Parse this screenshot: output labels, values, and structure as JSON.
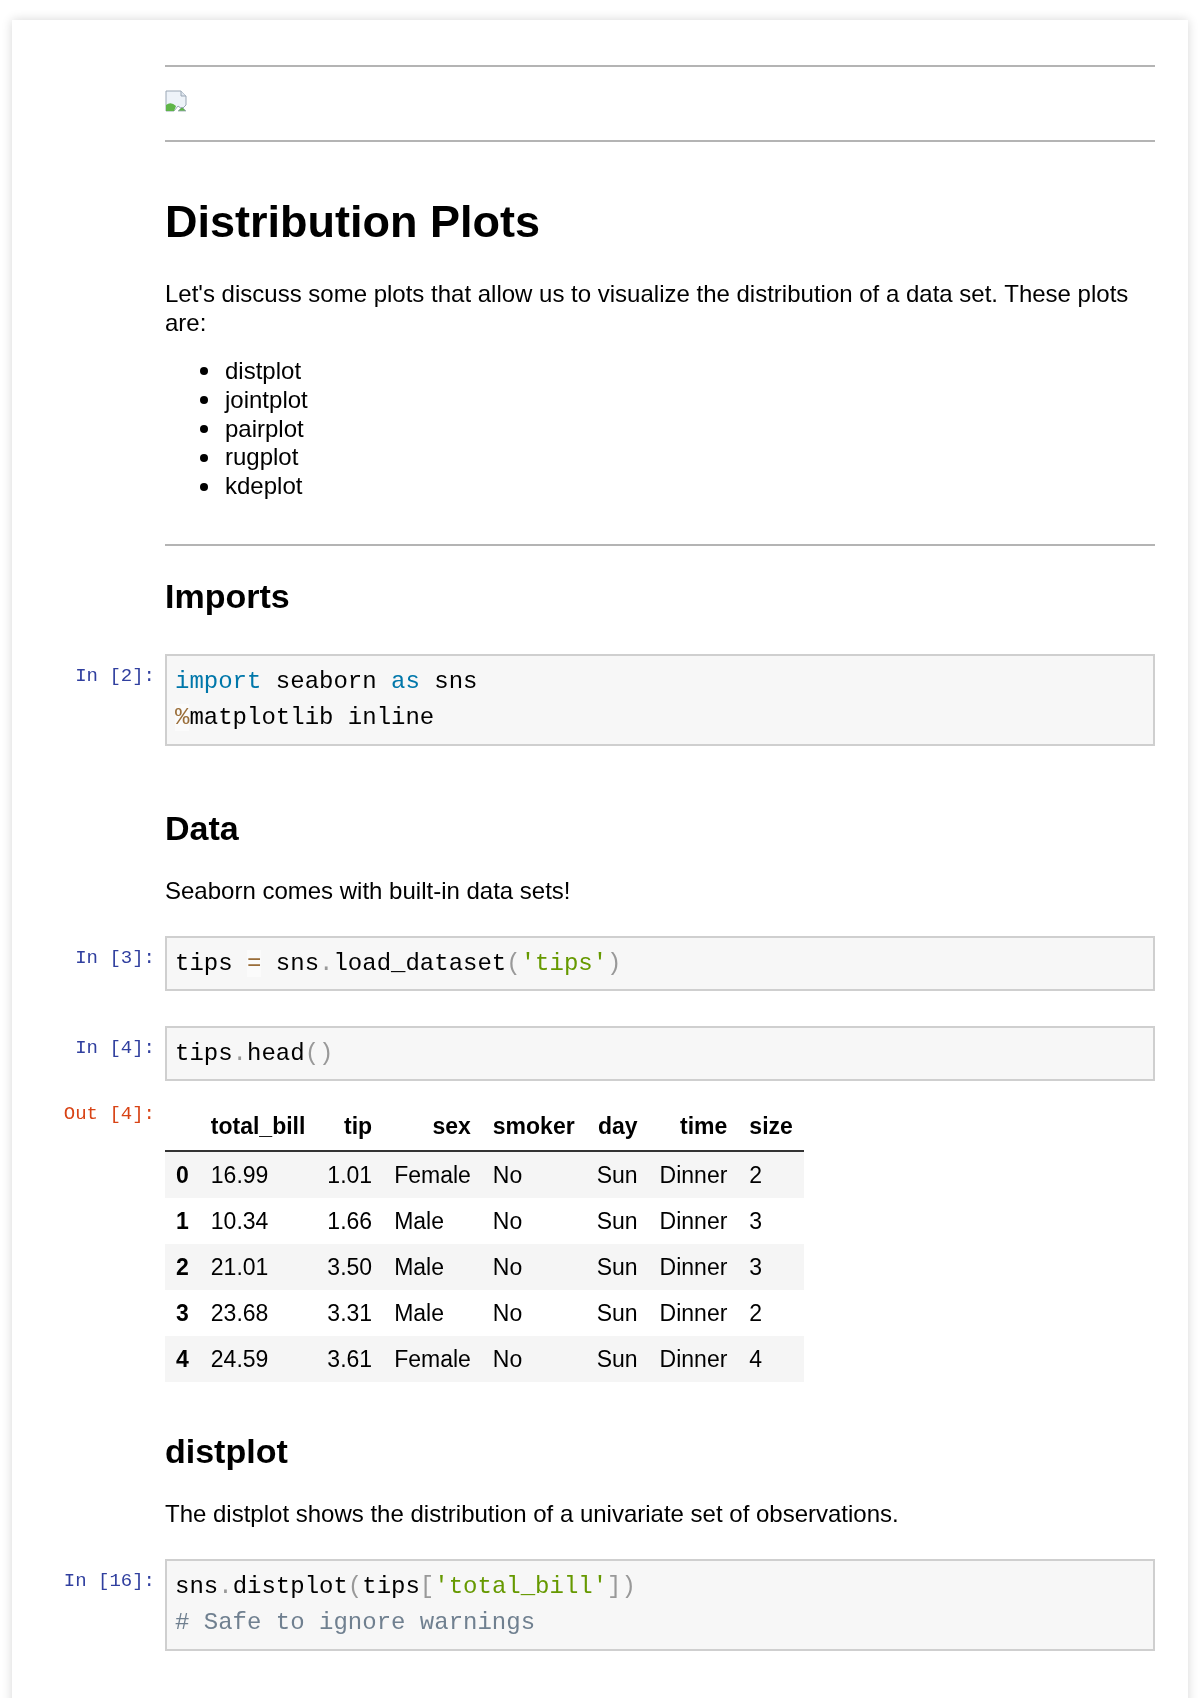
{
  "notebook": {
    "blocks": [
      {
        "kind": "rule"
      },
      {
        "kind": "image"
      },
      {
        "kind": "rule"
      },
      {
        "kind": "title",
        "text": "Distribution Plots"
      },
      {
        "kind": "paragraph",
        "text": "Let's discuss some plots that allow us to visualize the distribution of a data set. These plots are:"
      },
      {
        "kind": "list",
        "items": [
          "distplot",
          "jointplot",
          "pairplot",
          "rugplot",
          "kdeplot"
        ]
      },
      {
        "kind": "rule"
      },
      {
        "kind": "heading",
        "text": "Imports"
      },
      {
        "kind": "code",
        "prompt": "In [2]:",
        "lines": [
          [
            {
              "kind": "keyword",
              "text": "import"
            },
            {
              "kind": "plain",
              "text": " seaborn "
            },
            {
              "kind": "keyword",
              "text": "as"
            },
            {
              "kind": "plain",
              "text": " sns"
            }
          ],
          [
            {
              "kind": "operator",
              "text": "%"
            },
            {
              "kind": "plain",
              "text": "matplotlib inline"
            }
          ]
        ]
      },
      {
        "kind": "heading",
        "text": "Data"
      },
      {
        "kind": "paragraph",
        "text": "Seaborn comes with built-in data sets!"
      },
      {
        "kind": "code",
        "prompt": "In [3]:",
        "lines": [
          [
            {
              "kind": "plain",
              "text": "tips "
            },
            {
              "kind": "operator",
              "text": "="
            },
            {
              "kind": "plain",
              "text": " sns"
            },
            {
              "kind": "punctuation",
              "text": "."
            },
            {
              "kind": "plain",
              "text": "load_dataset"
            },
            {
              "kind": "punctuation",
              "text": "("
            },
            {
              "kind": "string",
              "text": "'tips'"
            },
            {
              "kind": "punctuation",
              "text": ")"
            }
          ]
        ]
      },
      {
        "kind": "code",
        "prompt": "In [4]:",
        "lines": [
          [
            {
              "kind": "plain",
              "text": "tips"
            },
            {
              "kind": "punctuation",
              "text": "."
            },
            {
              "kind": "plain",
              "text": "head"
            },
            {
              "kind": "punctuation",
              "text": "()"
            }
          ]
        ]
      },
      {
        "kind": "table",
        "prompt": "Out [4]:",
        "columns": [
          "total_bill",
          "tip",
          "sex",
          "smoker",
          "day",
          "time",
          "size"
        ],
        "rows": [
          {
            "index": "0",
            "cells": [
              "16.99",
              "1.01",
              "Female",
              "No",
              "Sun",
              "Dinner",
              "2"
            ]
          },
          {
            "index": "1",
            "cells": [
              "10.34",
              "1.66",
              "Male",
              "No",
              "Sun",
              "Dinner",
              "3"
            ]
          },
          {
            "index": "2",
            "cells": [
              "21.01",
              "3.50",
              "Male",
              "No",
              "Sun",
              "Dinner",
              "3"
            ]
          },
          {
            "index": "3",
            "cells": [
              "23.68",
              "3.31",
              "Male",
              "No",
              "Sun",
              "Dinner",
              "2"
            ]
          },
          {
            "index": "4",
            "cells": [
              "24.59",
              "3.61",
              "Female",
              "No",
              "Sun",
              "Dinner",
              "4"
            ]
          }
        ]
      },
      {
        "kind": "heading",
        "text": "distplot"
      },
      {
        "kind": "paragraph",
        "text": "The distplot shows the distribution of a univariate set of observations."
      },
      {
        "kind": "code",
        "prompt": "In [16]:",
        "lines": [
          [
            {
              "kind": "plain",
              "text": "sns"
            },
            {
              "kind": "punctuation",
              "text": "."
            },
            {
              "kind": "plain",
              "text": "distplot"
            },
            {
              "kind": "punctuation",
              "text": "("
            },
            {
              "kind": "plain",
              "text": "tips"
            },
            {
              "kind": "punctuation",
              "text": "["
            },
            {
              "kind": "string",
              "text": "'total_bill'"
            },
            {
              "kind": "punctuation",
              "text": "])"
            }
          ],
          [
            {
              "kind": "comment",
              "text": "# Safe to ignore warnings"
            }
          ]
        ]
      }
    ]
  }
}
